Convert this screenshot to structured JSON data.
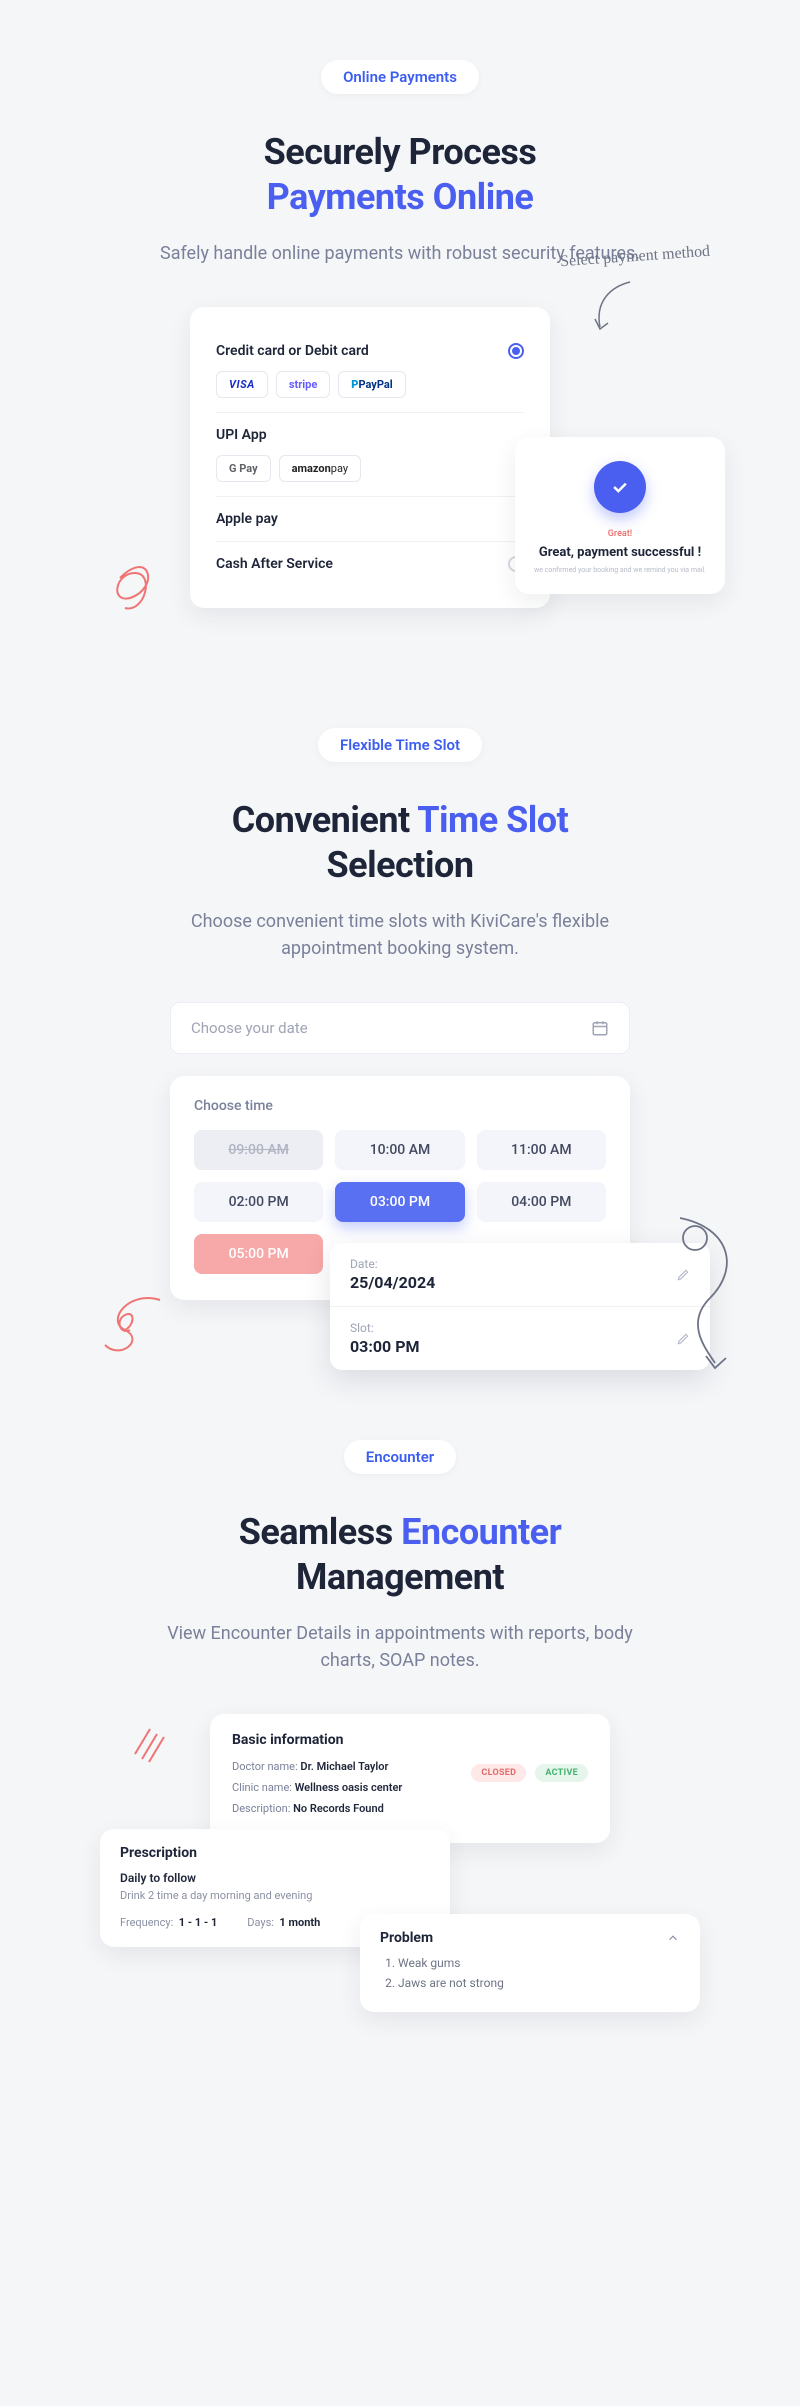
{
  "payments": {
    "badge": "Online Payments",
    "title_1": "Securely Process",
    "title_2": "Payments Online",
    "subtitle": "Safely handle online payments with robust security features.",
    "annotation": "Select payment method",
    "methods": {
      "cc": {
        "label": "Credit card or Debit card",
        "selected": true,
        "brands": {
          "visa": "VISA",
          "stripe": "stripe",
          "paypal_p": "P ",
          "paypal": "PayPal"
        }
      },
      "upi": {
        "label": "UPI App",
        "brands": {
          "gpay": "G Pay",
          "amazon": "amazon",
          "amazon_suffix": " pay"
        }
      },
      "apple": {
        "label": "Apple pay"
      },
      "cash": {
        "label": "Cash After Service"
      }
    },
    "success": {
      "tag": "Great!",
      "title": "Great, payment successful !",
      "sub": "we confirmed your booking and we remind you via mail."
    }
  },
  "timeslot": {
    "badge": "Flexible Time Slot",
    "title_pre": "Convenient ",
    "title_accent": "Time Slot",
    "title_post": " Selection",
    "subtitle": "Choose convenient time slots with KiviCare's flexible appointment booking system.",
    "date_placeholder": "Choose your date",
    "time_label": "Choose time",
    "slots": {
      "s1": "09:00 AM",
      "s2": "10:00 AM",
      "s3": "11:00 AM",
      "s4": "02:00 PM",
      "s5": "03:00 PM",
      "s6": "04:00 PM",
      "s7": "05:00 PM"
    },
    "confirm": {
      "date_lbl": "Date:",
      "date_val": "25/04/2024",
      "slot_lbl": "Slot:",
      "slot_val": "03:00 PM"
    }
  },
  "encounter": {
    "badge": "Encounter",
    "title_pre": "Seamless ",
    "title_accent": "Encounter",
    "title_post": " Management",
    "subtitle": "View Encounter Details in appointments with reports, body charts, SOAP notes.",
    "basic": {
      "heading": "Basic information",
      "doctor_lbl": "Doctor name: ",
      "doctor": "Dr. Michael Taylor",
      "clinic_lbl": "Clinic name: ",
      "clinic": "Wellness oasis center",
      "desc_lbl": "Description: ",
      "desc": "No Records Found",
      "closed": "CLOSED",
      "active": "ACTIVE"
    },
    "presc": {
      "heading": "Prescription",
      "subheading": "Daily to follow",
      "desc": "Drink 2 time a day morning and evening",
      "freq_lbl": "Frequency:",
      "freq": "1 - 1 - 1",
      "days_lbl": "Days:",
      "days": "1 month"
    },
    "problem": {
      "heading": "Problem",
      "p1": "Weak gums",
      "p2": "Jaws are not strong"
    }
  }
}
